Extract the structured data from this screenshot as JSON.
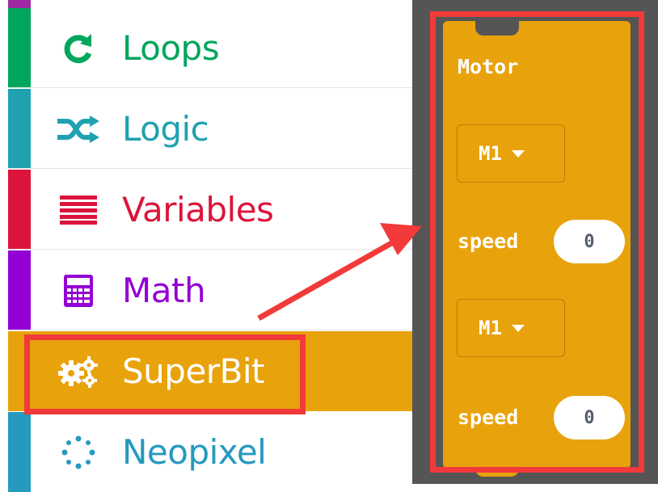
{
  "toolbox": {
    "categories": [
      {
        "label": "Loops",
        "icon": "loop-icon",
        "color": "#00a65c",
        "text_color": "#00a65c"
      },
      {
        "label": "Logic",
        "icon": "shuffle-icon",
        "color": "#1fa1b0",
        "text_color": "#1fa1b0"
      },
      {
        "label": "Variables",
        "icon": "list-icon",
        "color": "#dc143c",
        "text_color": "#dc143c"
      },
      {
        "label": "Math",
        "icon": "calculator-icon",
        "color": "#9400d3",
        "text_color": "#9400d3"
      },
      {
        "label": "SuperBit",
        "icon": "gears-icon",
        "color": "#e8a20c",
        "text_color": "#ffffff",
        "selected": true
      },
      {
        "label": "Neopixel",
        "icon": "dots-ring-icon",
        "color": "#2699bf",
        "text_color": "#2699bf"
      }
    ]
  },
  "block": {
    "title": "Motor",
    "motor1": {
      "value": "M1"
    },
    "speed1": {
      "label": "speed",
      "value": "0"
    },
    "motor2": {
      "value": "M1"
    },
    "speed2": {
      "label": "speed",
      "value": "0"
    },
    "color": "#e8a20c"
  },
  "annotation": {
    "color": "#f23a3a"
  }
}
